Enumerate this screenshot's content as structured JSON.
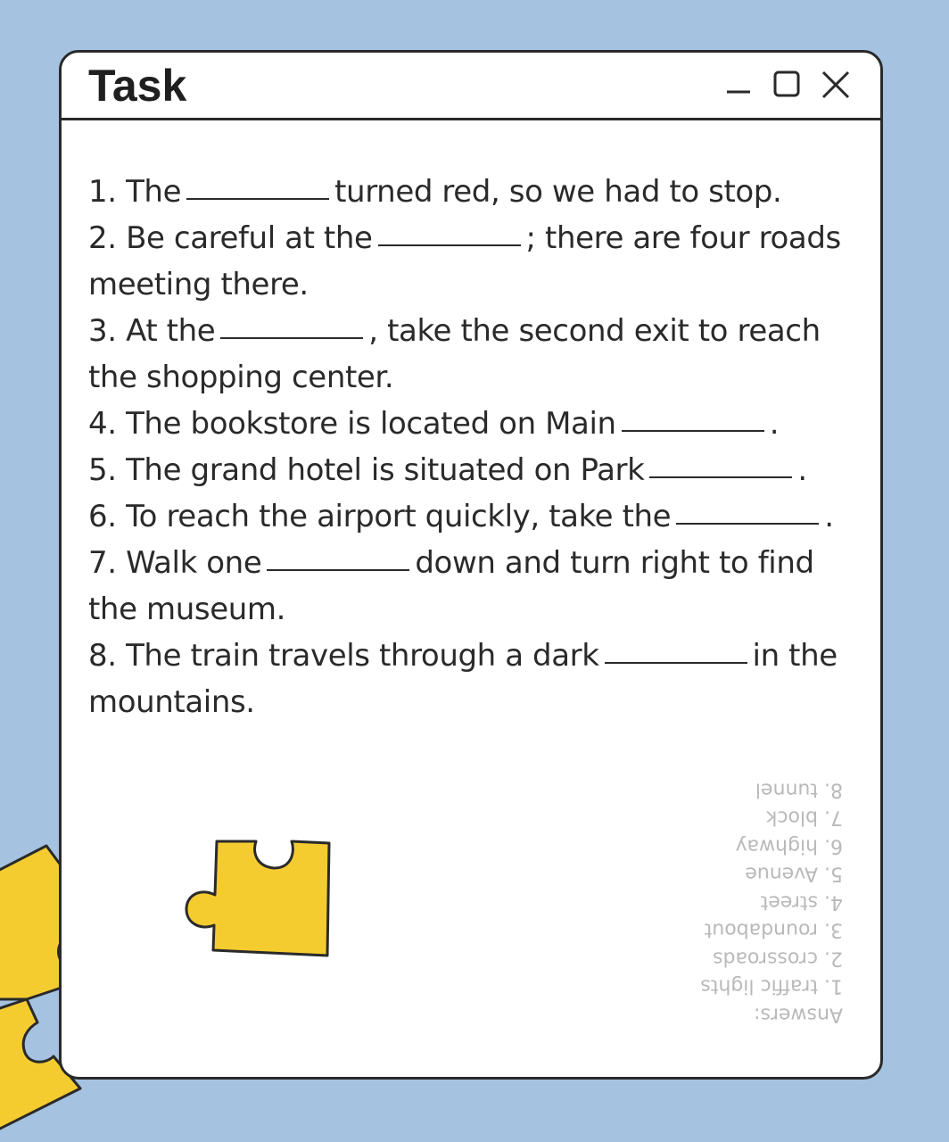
{
  "window": {
    "title": "Task",
    "controls": [
      {
        "name": "minimize",
        "icon": "minimize-icon"
      },
      {
        "name": "maximize",
        "icon": "maximize-icon"
      },
      {
        "name": "close",
        "icon": "close-icon"
      }
    ]
  },
  "questions": [
    {
      "number": "1.",
      "before": "The",
      "after": "turned red, so we had to stop."
    },
    {
      "number": "2.",
      "before": "Be careful at the",
      "after": "; there are four roads meeting there."
    },
    {
      "number": "3.",
      "before": "At the",
      "after": ", take the second exit to reach the shopping center."
    },
    {
      "number": "4.",
      "before": "The bookstore is located on Main",
      "after": "."
    },
    {
      "number": "5.",
      "before": "The grand hotel is situated on Park",
      "after": "."
    },
    {
      "number": "6.",
      "before": "To reach the airport quickly, take the",
      "after": "."
    },
    {
      "number": "7.",
      "before": "Walk one",
      "after": "down and turn right to find the museum."
    },
    {
      "number": "8.",
      "before": "The train travels through a dark",
      "after": "in the mountains."
    }
  ],
  "answers": {
    "heading": "Answers:",
    "items": [
      "1. traffic lights",
      "2. crossroads",
      "3. roundabout",
      "4. street",
      "5. Avenue",
      "6. highway",
      "7. block",
      "8. tunnel"
    ]
  },
  "colors": {
    "background": "#a5c2e1",
    "window": "#ffffff",
    "border": "#2a2a2a",
    "text": "#2a2a2a",
    "answers_text": "#b9b9b9",
    "puzzle": "#f5cc30"
  }
}
